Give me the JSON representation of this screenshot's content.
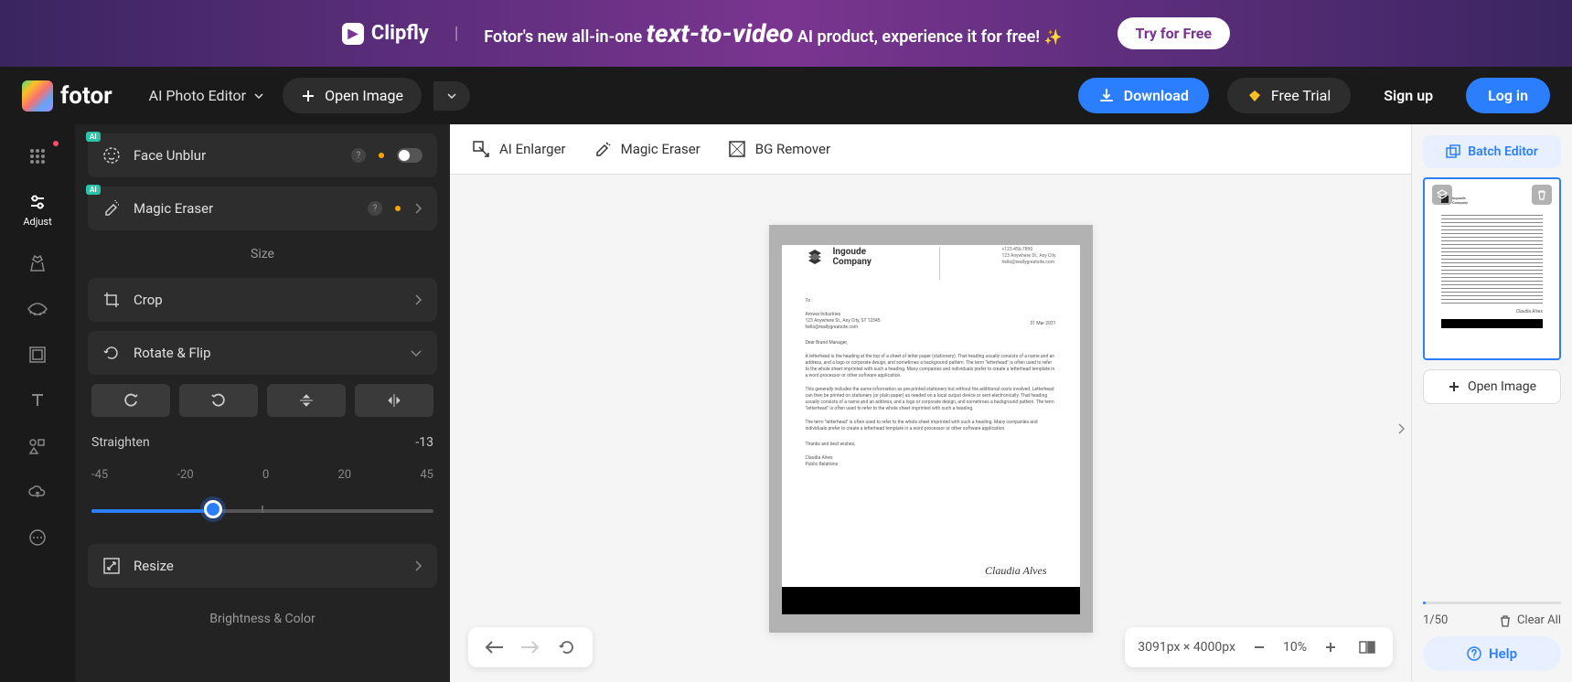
{
  "banner": {
    "logo": "Clipfly",
    "text_pre": "Fotor's new all-in-one ",
    "highlight": "text-to-video",
    "text_post": " AI product, experience it for free!",
    "cta": "Try for Free"
  },
  "header": {
    "logo_text": "fotor",
    "editor_dropdown": "AI Photo Editor",
    "open_image": "Open Image",
    "download": "Download",
    "free_trial": "Free Trial",
    "sign_up": "Sign up",
    "log_in": "Log in"
  },
  "rail": {
    "adjust": "Adjust"
  },
  "panel": {
    "face_unblur": "Face Unblur",
    "magic_eraser": "Magic Eraser",
    "size_section": "Size",
    "crop": "Crop",
    "rotate_flip": "Rotate & Flip",
    "straighten_label": "Straighten",
    "straighten_value": "-13",
    "ticks": [
      "-45",
      "-20",
      "0",
      "20",
      "45"
    ],
    "resize": "Resize",
    "brightness_section": "Brightness & Color"
  },
  "canvas_tools": {
    "ai_enlarger": "AI Enlarger",
    "magic_eraser": "Magic Eraser",
    "bg_remover": "BG Remover"
  },
  "document": {
    "company": "Ingoude Company",
    "contact_line1": "+123-456-7890",
    "contact_line2": "123 Anywhere St., Any City",
    "contact_line3": "hello@reallygreatsite.com",
    "to": "To :",
    "addr1": "Arowai Industries",
    "addr2": "123 Anywhere St., Any City, ST 12345",
    "addr3": "hello@reallygreatsite.com",
    "date": "31 Mar 2031",
    "salutation": "Dear Brand Manager,",
    "p1": "A letterhead is the heading at the top of a sheet of letter paper (stationery). That heading usually consists of a name and an address, and a logo or corporate design, and sometimes a background pattern. The term \"letterhead\" is often used to refer to the whole sheet imprinted with such a heading. Many companies and individuals prefer to create a letterhead template in a word processor or other software application.",
    "p2": "This generally includes the same information as pre-printed stationery but without the additional costs involved. Letterhead can then be printed on stationery (or plain paper) as needed on a local output device or sent electronically. That heading usually consists of a name and an address, and a logo or corporate design, and sometimes a background pattern. The term \"letterhead\" is often used to refer to the whole sheet imprinted with such a heading.",
    "p3": "The term \"letterhead\" is often used to refer to the whole sheet imprinted with such a heading. Many companies and individuals prefer to create a letterhead template in a word processor or other software application.",
    "closing": "Thanks and best wishes,",
    "name": "Claudia Alves",
    "role": "Public Relations",
    "signature": "Claudia Alves"
  },
  "bottom": {
    "dimensions": "3091px × 4000px",
    "zoom": "10%"
  },
  "right": {
    "batch_editor": "Batch Editor",
    "open_image": "Open Image",
    "count": "1/50",
    "clear_all": "Clear All",
    "help": "Help"
  }
}
